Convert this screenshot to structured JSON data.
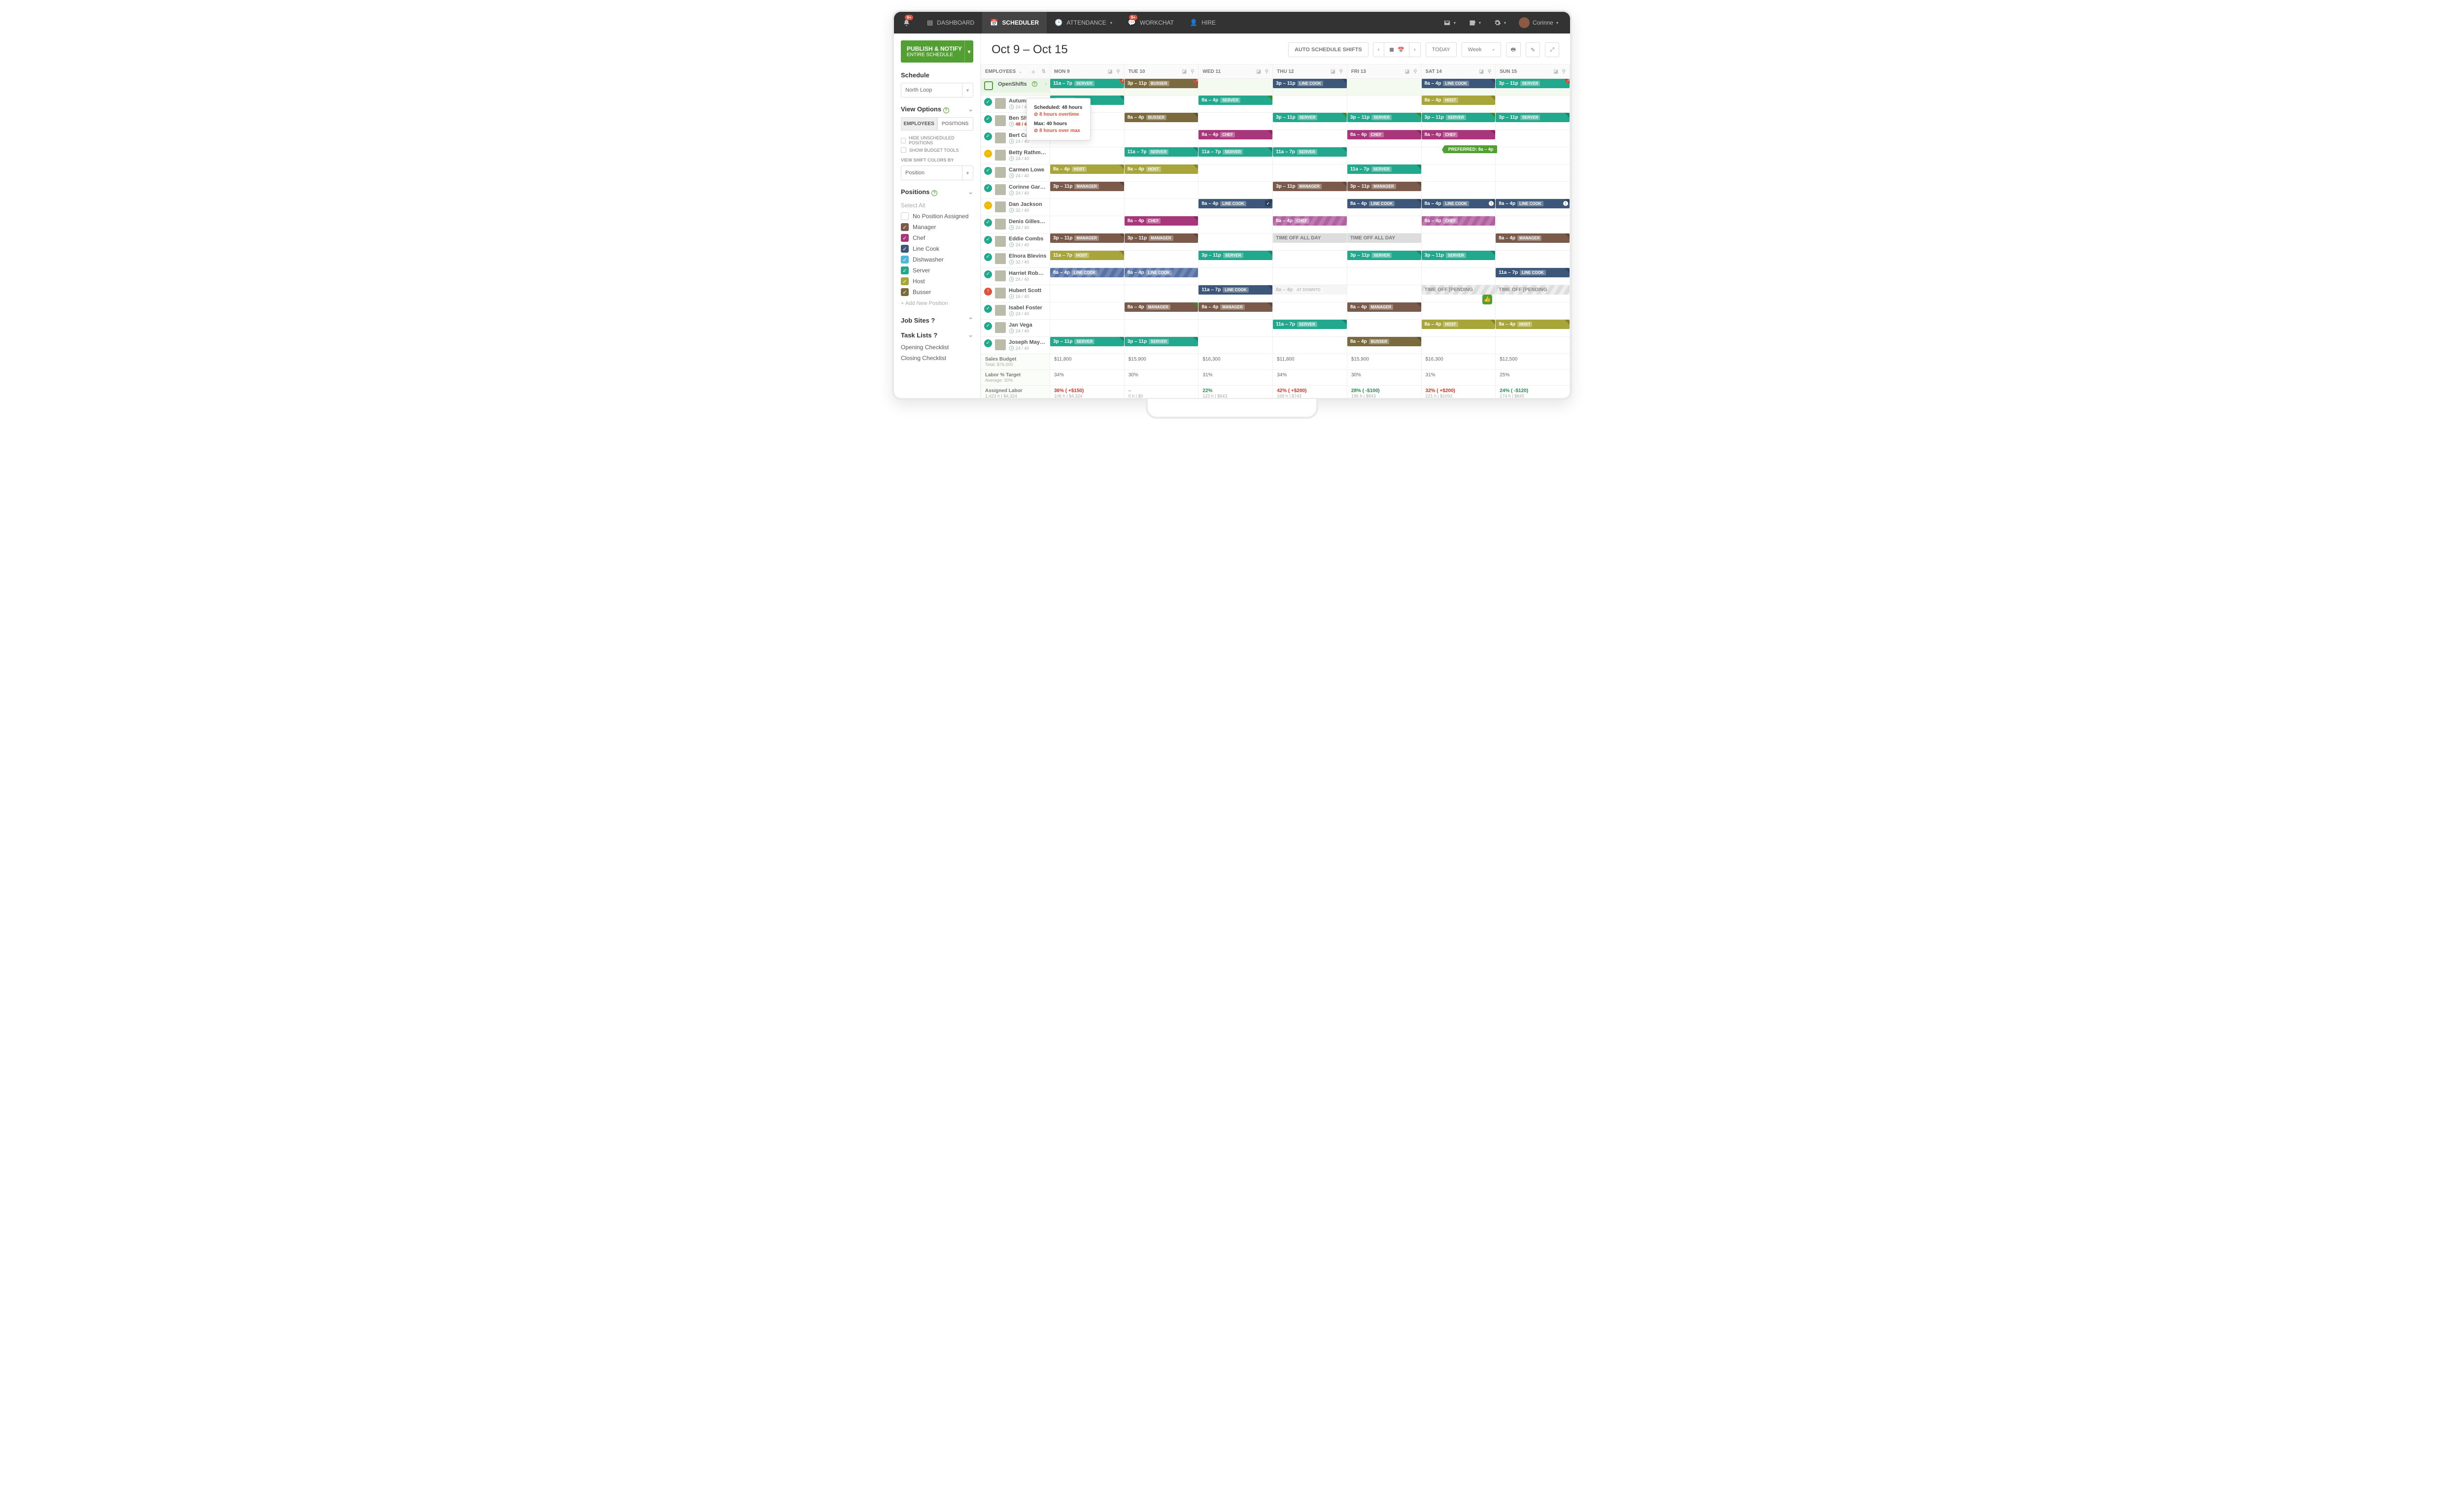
{
  "topnav": {
    "notif_badge": "9+",
    "items": [
      {
        "label": "DASHBOARD",
        "active": false
      },
      {
        "label": "SCHEDULER",
        "active": true
      },
      {
        "label": "ATTENDANCE",
        "active": false,
        "dd": true
      },
      {
        "label": "WORKCHAT",
        "active": false,
        "badge": "9+"
      },
      {
        "label": "HIRE",
        "active": false
      }
    ],
    "user": "Corinne"
  },
  "sidebar": {
    "publish": {
      "line1": "PUBLISH & NOTIFY",
      "line2": "ENTIRE SCHEDULE"
    },
    "schedule_label": "Schedule",
    "schedule_value": "North Loop",
    "view_options_label": "View Options",
    "toggle": {
      "a": "EMPLOYEES",
      "b": "POSITIONS"
    },
    "hide_unscheduled": "HIDE UNSCHEDULED POSITIONS",
    "show_budget": "SHOW BUDGET TOOLS",
    "colors_label": "VIEW SHIFT COLORS BY",
    "colors_value": "Position",
    "positions_label": "Positions",
    "select_all": "Select All",
    "positions": [
      {
        "label": "No Position Assigned",
        "color": "",
        "checked": false
      },
      {
        "label": "Manager",
        "color": "#7a5a4a",
        "checked": true
      },
      {
        "label": "Chef",
        "color": "#a8367a",
        "checked": true
      },
      {
        "label": "Line Cook",
        "color": "#3c577a",
        "checked": true
      },
      {
        "label": "Dishwasher",
        "color": "#4db8d8",
        "checked": true
      },
      {
        "label": "Server",
        "color": "#22a88c",
        "checked": true
      },
      {
        "label": "Host",
        "color": "#a8a53a",
        "checked": true
      },
      {
        "label": "Busser",
        "color": "#7a6a3d",
        "checked": true
      }
    ],
    "add_position": "+ Add New Position",
    "jobsites_label": "Job Sites",
    "tasklists_label": "Task Lists",
    "tasklists": [
      "Opening Checklist",
      "Closing Checklist"
    ]
  },
  "main": {
    "title": "Oct 9 – Oct 15",
    "auto_btn": "AUTO SCHEDULE SHIFTS",
    "today": "TODAY",
    "range": "Week",
    "cols": [
      "MON 9",
      "TUE 10",
      "WED 11",
      "THU 12",
      "FRI 13",
      "SAT 14",
      "SUN 15"
    ],
    "emp_header": "EMPLOYEES",
    "openshifts_label": "OpenShifts",
    "openshifts": [
      {
        "c": "server",
        "t": "11a – 7p",
        "p": "SERVER",
        "dot": "2"
      },
      {
        "c": "busser",
        "t": "3p – 11p",
        "p": "BUSSER",
        "dot": "3"
      },
      null,
      {
        "c": "linecook",
        "t": "3p – 11p",
        "p": "LINE COOK"
      },
      null,
      {
        "c": "linecook",
        "t": "8a – 4p",
        "p": "LINE COOK"
      },
      {
        "c": "server",
        "t": "3p – 11p",
        "p": "SERVER",
        "dot": "2"
      }
    ],
    "employees": [
      {
        "name": "Autumn Ro...",
        "hrs": "24 / 40",
        "ind": "ok",
        "shifts": [
          {
            "c": "server",
            "t": "",
            "p": "SERVER"
          },
          null,
          {
            "c": "server",
            "t": "8a – 4p",
            "p": "SERVER",
            "tri": "g"
          },
          null,
          null,
          {
            "c": "host",
            "t": "8a – 4p",
            "p": "HOST"
          },
          null
        ]
      },
      {
        "name": "Ben Shield...",
        "hrs": "48 / 40",
        "ind": "ok",
        "red": true,
        "shifts": [
          null,
          {
            "c": "busser",
            "t": "8a – 4p",
            "p": "BUSSER"
          },
          null,
          {
            "c": "server",
            "t": "3p – 11p",
            "p": "SERVER",
            "tri": "g"
          },
          {
            "c": "server",
            "t": "3p – 11p",
            "p": "SERVER",
            "tri": "g"
          },
          {
            "c": "server",
            "t": "3p – 11p",
            "p": "SERVER",
            "tri": "g"
          },
          {
            "c": "server",
            "t": "3p – 11p",
            "p": "SERVER"
          }
        ]
      },
      {
        "name": "Bert Castro",
        "hrs": "24 / 40",
        "ind": "ok",
        "shifts": [
          null,
          null,
          {
            "c": "chef",
            "t": "8a – 4p",
            "p": "CHEF"
          },
          null,
          {
            "c": "chef",
            "t": "8a – 4p",
            "p": "CHEF"
          },
          {
            "c": "chef",
            "t": "8a – 4p",
            "p": "CHEF"
          },
          null
        ]
      },
      {
        "name": "Betty Rathmen",
        "hrs": "24 / 40",
        "ind": "warn",
        "shifts": [
          null,
          {
            "c": "server",
            "t": "11a – 7p",
            "p": "SERVER"
          },
          {
            "c": "server",
            "t": "11a – 7p",
            "p": "SERVER"
          },
          {
            "c": "server",
            "t": "11a – 7p",
            "p": "SERVER"
          },
          null,
          null,
          null
        ],
        "pref": "PREFERRED: 8a – 4p"
      },
      {
        "name": "Carmen Lowe",
        "hrs": "24 / 40",
        "ind": "ok",
        "shifts": [
          {
            "c": "host",
            "t": "8a – 4p",
            "p": "HOST"
          },
          {
            "c": "host",
            "t": "8a – 4p",
            "p": "HOST"
          },
          null,
          null,
          {
            "c": "server",
            "t": "11a – 7p",
            "p": "SERVER"
          },
          null,
          null
        ]
      },
      {
        "name": "Corinne Garris...",
        "hrs": "24 / 40",
        "ind": "ok",
        "shifts": [
          {
            "c": "manager",
            "t": "3p – 11p",
            "p": "MANAGER"
          },
          null,
          null,
          {
            "c": "manager",
            "t": "3p – 11p",
            "p": "MANAGER"
          },
          {
            "c": "manager",
            "t": "3p – 11p",
            "p": "MANAGER"
          },
          null,
          null
        ]
      },
      {
        "name": "Dan Jackson",
        "hrs": "32 / 40",
        "ind": "warn",
        "shifts": [
          null,
          null,
          {
            "c": "linecook",
            "t": "8a – 4p",
            "p": "LINE COOK",
            "tick": true
          },
          null,
          {
            "c": "linecook",
            "t": "8a – 4p",
            "p": "LINE COOK"
          },
          {
            "c": "linecook",
            "t": "8a – 4p",
            "p": "LINE COOK",
            "warn": true
          },
          {
            "c": "linecook",
            "t": "8a – 4p",
            "p": "LINE COOK",
            "warn": true
          }
        ]
      },
      {
        "name": "Denis Gillespie",
        "hrs": "24 / 40",
        "ind": "ok",
        "shifts": [
          null,
          {
            "c": "chef",
            "t": "8a – 4p",
            "p": "CHEF"
          },
          null,
          {
            "c": "striped",
            "t": "8a – 4p",
            "p": "CHEF"
          },
          null,
          {
            "c": "striped",
            "t": "8a – 4p",
            "p": "CHEF"
          },
          null
        ]
      },
      {
        "name": "Eddie Combs",
        "hrs": "24 / 40",
        "ind": "ok",
        "shifts": [
          {
            "c": "manager",
            "t": "3p – 11p",
            "p": "MANAGER"
          },
          {
            "c": "manager",
            "t": "3p – 11p",
            "p": "MANAGER"
          },
          null,
          {
            "c": "timeoff",
            "t": "TIME OFF ALL DAY"
          },
          {
            "c": "timeoff",
            "t": "TIME OFF ALL DAY"
          },
          null,
          {
            "c": "manager",
            "t": "8a – 4p",
            "p": "MANAGER"
          }
        ]
      },
      {
        "name": "Elnora Blevins",
        "hrs": "32 / 40",
        "ind": "ok",
        "shifts": [
          {
            "c": "host",
            "t": "11a – 7p",
            "p": "HOST"
          },
          null,
          {
            "c": "server",
            "t": "3p – 11p",
            "p": "SERVER"
          },
          null,
          {
            "c": "server",
            "t": "3p – 11p",
            "p": "SERVER"
          },
          {
            "c": "server",
            "t": "3p – 11p",
            "p": "SERVER"
          },
          null
        ]
      },
      {
        "name": "Harriet Roberts",
        "hrs": "24 / 40",
        "ind": "ok",
        "shifts": [
          {
            "c": "striped-blue",
            "t": "8a – 4p",
            "p": "LINE COOK"
          },
          {
            "c": "striped-blue",
            "t": "8a – 4p",
            "p": "LINE COOK"
          },
          null,
          null,
          null,
          null,
          {
            "c": "linecook",
            "t": "11a – 7p",
            "p": "LINE COOK"
          }
        ]
      },
      {
        "name": "Hubert Scott",
        "hrs": "16 / 40",
        "ind": "err",
        "shifts": [
          null,
          null,
          {
            "c": "linecook",
            "t": "11a – 7p",
            "p": "LINE COOK"
          },
          {
            "c": "ghost",
            "t": "8a – 4p",
            "p": "AT DOWNTO"
          },
          null,
          {
            "c": "pending",
            "t": "TIME OFF [PENDING"
          },
          {
            "c": "pending",
            "t": "TIME OFF [PENDING"
          }
        ]
      },
      {
        "name": "Isabel Foster",
        "hrs": "24 / 40",
        "ind": "ok",
        "shifts": [
          null,
          {
            "c": "manager",
            "t": "8a – 4p",
            "p": "MANAGER",
            "tri": "g"
          },
          {
            "c": "manager",
            "t": "8a – 4p",
            "p": "MANAGER"
          },
          null,
          {
            "c": "manager",
            "t": "8a – 4p",
            "p": "MANAGER"
          },
          null,
          null
        ],
        "thumb": 5
      },
      {
        "name": "Jan Vega",
        "hrs": "24 / 40",
        "ind": "ok",
        "shifts": [
          null,
          null,
          null,
          {
            "c": "server",
            "t": "11a – 7p",
            "p": "SERVER"
          },
          null,
          {
            "c": "host",
            "t": "8a – 4p",
            "p": "HOST"
          },
          {
            "c": "host",
            "t": "8a – 4p",
            "p": "HOST"
          }
        ]
      },
      {
        "name": "Joseph Mayna...",
        "hrs": "24 / 40",
        "ind": "ok",
        "shifts": [
          {
            "c": "server",
            "t": "3p – 11p",
            "p": "SERVER"
          },
          {
            "c": "server",
            "t": "3p – 11p",
            "p": "SERVER"
          },
          null,
          null,
          {
            "c": "busser",
            "t": "8a – 4p",
            "p": "BUSSER"
          },
          null,
          null
        ]
      }
    ],
    "tooltip": {
      "scheduled": "Scheduled: 48 hours",
      "overtime": "8 hours overtime",
      "max": "Max: 40 hours",
      "overmax": "8 hours over max"
    },
    "summary": [
      {
        "label": "Sales Budget",
        "sub": "Total:  $76,000",
        "cells": [
          "$11,800",
          "$15,900",
          "$16,300",
          "$11,800",
          "$15,900",
          "$16,300",
          "$12,500"
        ]
      },
      {
        "label": "Labor % Target",
        "sub": "Average:  30%",
        "cells": [
          "34%",
          "30%",
          "31%",
          "34%",
          "30%",
          "31%",
          "25%"
        ]
      },
      {
        "label": "Assigned Labor",
        "sub": "1,423 h | $4,324",
        "cells": [
          {
            "v": "36% ( +$150)",
            "s": "106 h | $4,324",
            "c": "red"
          },
          {
            "v": "–",
            "s": "0 h | $0"
          },
          {
            "v": "22%",
            "s": "123 h | $643",
            "c": "green"
          },
          {
            "v": "42% ( +$200)",
            "s": "168 h | $743",
            "c": "red"
          },
          {
            "v": "28% ( -$100)",
            "s": "196 h | $843",
            "c": "green"
          },
          {
            "v": "32% ( +$200)",
            "s": "221 h | $1092",
            "c": "red"
          },
          {
            "v": "24% ( -$120)",
            "s": "174 h | $845",
            "c": "green"
          }
        ]
      }
    ]
  }
}
